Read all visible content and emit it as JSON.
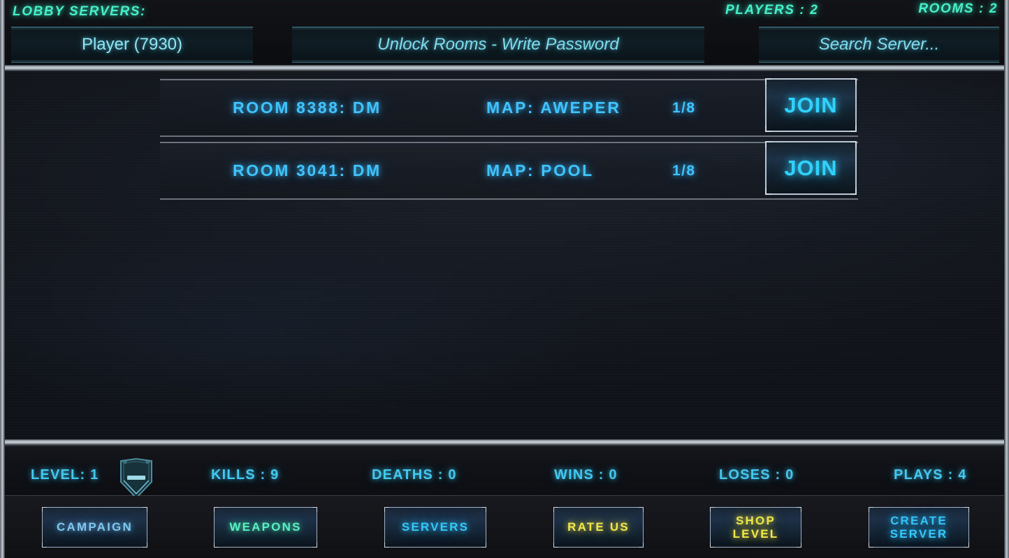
{
  "header": {
    "lobby_title": "LOBBY SERVERS:",
    "players_stat": "PLAYERS : 2",
    "rooms_stat": "ROOMS : 2",
    "player_field_value": "Player (7930)",
    "password_field_placeholder": "Unlock Rooms - Write Password",
    "search_field_placeholder": "Search  Server..."
  },
  "rooms": [
    {
      "name": "ROOM 8388: DM",
      "map": "MAP: AWEPER",
      "count": "1/8",
      "join_label": "JOIN"
    },
    {
      "name": "ROOM 3041: DM",
      "map": "MAP: POOL",
      "count": "1/8",
      "join_label": "JOIN"
    }
  ],
  "stats": {
    "level": "LEVEL: 1",
    "kills": "KILLS : 9",
    "deaths": "DEATHS : 0",
    "wins": "WINS : 0",
    "loses": "LOSES : 0",
    "plays": "PLAYS : 4",
    "rank_badge_icon": "shield-rank-icon"
  },
  "nav": {
    "campaign": "CAMPAIGN",
    "weapons": "WEAPONS",
    "servers": "SERVERS",
    "rate_us": "RATE US",
    "shop_level": "SHOP\nLEVEL",
    "create_server": "CREATE\nSERVER"
  },
  "colors": {
    "accent_cyan": "#35c8ff",
    "accent_teal": "#46f0c8",
    "accent_blue": "#3fc4ff",
    "accent_yellow": "#f2e84a",
    "accent_green": "#5bf0c0",
    "frame_chrome": "#ccd2d8",
    "background": "#0f1218"
  }
}
